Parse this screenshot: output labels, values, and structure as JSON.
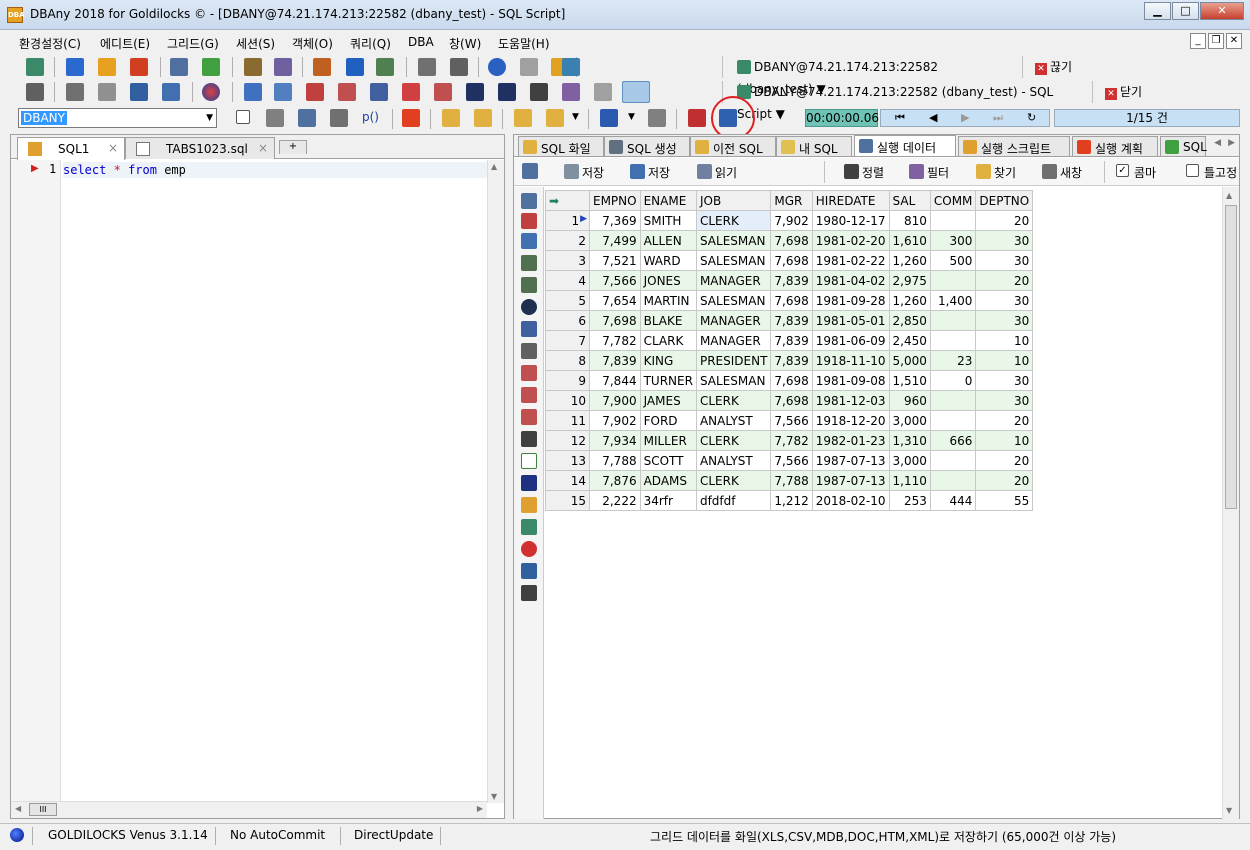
{
  "window": {
    "title": "DBAny 2018 for Goldilocks © - [DBANY@74.21.174.213:22582 (dbany_test) - SQL Script]",
    "app_icon": "DBA"
  },
  "menu": [
    "환경설정(C)",
    "에디트(E)",
    "그리드(G)",
    "세션(S)",
    "객체(O)",
    "쿼리(Q)",
    "DBA",
    "창(W)",
    "도움말(H)"
  ],
  "connection": {
    "row1": "DBANY@74.21.174.213:22582 (dbany_test) ▼",
    "row1_btn": "끊기",
    "row2": "DBANY@74.21.174.213:22582 (dbany_test) - SQL Script ▼",
    "row2_btn": "닫기"
  },
  "schema_combo": "DBANY",
  "timer": "00:00:00.06",
  "pager": "1/15 건",
  "editor": {
    "tabs": [
      "SQL1",
      "TABS1023.sql"
    ],
    "line_number": "1",
    "code": {
      "k1": "select",
      "op": "*",
      "k2": "from",
      "rest": "emp"
    },
    "hscroll_label": "III"
  },
  "result_tabs": [
    "SQL 화일",
    "SQL 생성",
    "이전 SQL",
    "내 SQL",
    "실행 데이터",
    "실행 스크립트",
    "실행 계획",
    "SQL"
  ],
  "grid_toolbar": {
    "save1": "저장",
    "save2": "저장",
    "read": "읽기",
    "sort": "정렬",
    "filter": "필터",
    "find": "찾기",
    "newwin": "새창",
    "comma": "콤마",
    "fixed": "틀고정"
  },
  "columns": [
    "EMPNO",
    "ENAME",
    "JOB",
    "MGR",
    "HIREDATE",
    "SAL",
    "COMM",
    "DEPTNO"
  ],
  "rows": [
    [
      "7,369",
      "SMITH",
      "CLERK",
      "7,902",
      "1980-12-17",
      "810",
      "",
      "20"
    ],
    [
      "7,499",
      "ALLEN",
      "SALESMAN",
      "7,698",
      "1981-02-20",
      "1,610",
      "300",
      "30"
    ],
    [
      "7,521",
      "WARD",
      "SALESMAN",
      "7,698",
      "1981-02-22",
      "1,260",
      "500",
      "30"
    ],
    [
      "7,566",
      "JONES",
      "MANAGER",
      "7,839",
      "1981-04-02",
      "2,975",
      "",
      "20"
    ],
    [
      "7,654",
      "MARTIN",
      "SALESMAN",
      "7,698",
      "1981-09-28",
      "1,260",
      "1,400",
      "30"
    ],
    [
      "7,698",
      "BLAKE",
      "MANAGER",
      "7,839",
      "1981-05-01",
      "2,850",
      "",
      "30"
    ],
    [
      "7,782",
      "CLARK",
      "MANAGER",
      "7,839",
      "1981-06-09",
      "2,450",
      "",
      "10"
    ],
    [
      "7,839",
      "KING",
      "PRESIDENT",
      "7,839",
      "1918-11-10",
      "5,000",
      "23",
      "10"
    ],
    [
      "7,844",
      "TURNER",
      "SALESMAN",
      "7,698",
      "1981-09-08",
      "1,510",
      "0",
      "30"
    ],
    [
      "7,900",
      "JAMES",
      "CLERK",
      "7,698",
      "1981-12-03",
      "960",
      "",
      "30"
    ],
    [
      "7,902",
      "FORD",
      "ANALYST",
      "7,566",
      "1918-12-20",
      "3,000",
      "",
      "20"
    ],
    [
      "7,934",
      "MILLER",
      "CLERK",
      "7,782",
      "1982-01-23",
      "1,310",
      "666",
      "10"
    ],
    [
      "7,788",
      "SCOTT",
      "ANALYST",
      "7,566",
      "1987-07-13",
      "3,000",
      "",
      "20"
    ],
    [
      "7,876",
      "ADAMS",
      "CLERK",
      "7,788",
      "1987-07-13",
      "1,110",
      "",
      "20"
    ],
    [
      "2,222",
      "34rfr",
      "dfdfdf",
      "1,212",
      "2018-02-10",
      "253",
      "444",
      "55"
    ]
  ],
  "status": {
    "db": "GOLDILOCKS Venus 3.1.14",
    "commit": "No AutoCommit",
    "update": "DirectUpdate",
    "message": "그리드 데이터를 화일(XLS,CSV,MDB,DOC,HTM,XML)로 저장하기 (65,000건 이상 가능)"
  }
}
